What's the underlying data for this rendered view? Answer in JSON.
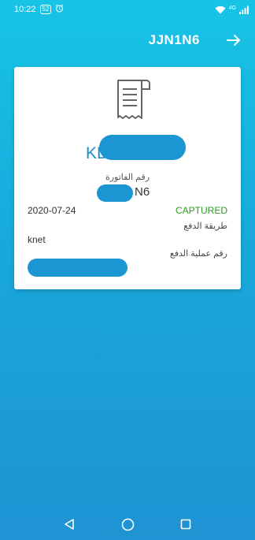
{
  "status_bar": {
    "time": "10:22",
    "battery": "52",
    "alarm_icon": "alarm-icon",
    "network": "4G",
    "wifi_icon": "wifi-icon",
    "signal_icon": "signal-icon"
  },
  "app_bar": {
    "title": "JJN1N6",
    "forward_icon": "arrow-right-icon"
  },
  "receipt": {
    "icon": "receipt-icon",
    "amount_currency": "KD",
    "invoice_label": "رقم الفاتورة",
    "invoice_suffix": "N6",
    "date": "2020-07-24",
    "status": "CAPTURED",
    "status_color": "#2e9b22",
    "payment_method_label": "طريقة الدفع",
    "payment_method_value": "knet",
    "payment_reference_label": "رقم عملية الدفع"
  },
  "colors": {
    "accent": "#1a8fd0",
    "redaction": "#1c95d3",
    "background_top": "#17c4e6",
    "background_bottom": "#1f93d3"
  },
  "nav_bar": {
    "back_icon": "back-triangle-icon",
    "home_icon": "home-circle-icon",
    "recents_icon": "recents-square-icon"
  }
}
